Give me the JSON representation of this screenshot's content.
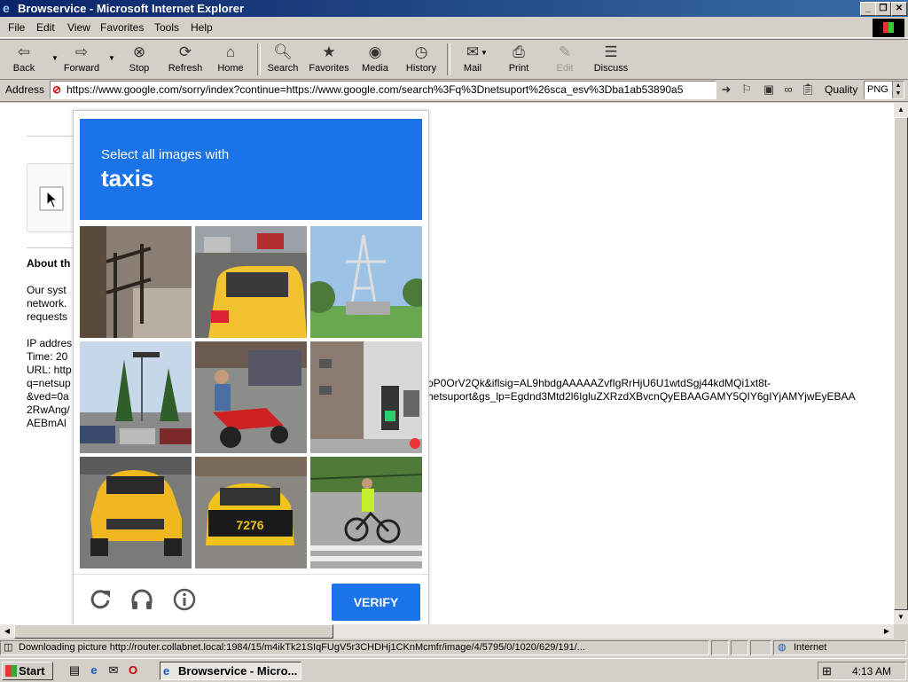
{
  "window": {
    "title": "Browservice - Microsoft Internet Explorer",
    "icon": "ie-icon",
    "buttons": [
      "minimize",
      "restore",
      "close"
    ]
  },
  "menu": [
    "File",
    "Edit",
    "View",
    "Favorites",
    "Tools",
    "Help"
  ],
  "toolbar": {
    "back": "Back",
    "forward": "Forward",
    "stop": "Stop",
    "refresh": "Refresh",
    "home": "Home",
    "search": "Search",
    "favorites": "Favorites",
    "media": "Media",
    "history": "History",
    "mail": "Mail",
    "print": "Print",
    "edit": "Edit",
    "discuss": "Discuss"
  },
  "address": {
    "label": "Address",
    "url": "https://www.google.com/sorry/index?continue=https://www.google.com/search%3Fq%3Dnetsuport%26sca_esv%3Dba1ab53890a5",
    "quality_label": "Quality",
    "quality_value": "PNG"
  },
  "page": {
    "about_heading": "About th",
    "body_lines": [
      "Our syst",
      "network.",
      "requests"
    ],
    "ip_line": "IP addres",
    "time_line": "Time: 20",
    "url_line": "URL: http",
    "q_line": "q=netsup",
    "ved_line": "&ved=0a",
    "rw_line": "2RwAng/",
    "aeb_line": "AEBmAl",
    "right_line_1": "oP0OrV2Qk&iflsig=AL9hbdgAAAAAZvfIgRrHjU6U1wtdSgj44kdMQi1xt8t-",
    "right_line_2": "netsuport&gs_lp=Egdnd3Mtd2l6IgluZXRzdXBvcnQyEBAAGAMY5QIY6gIYjAMYjwEyEBAA"
  },
  "captcha": {
    "instruction": "Select all images with",
    "object": "taxis",
    "verify_label": "VERIFY",
    "accent": "#1a73e8",
    "tiles": [
      {
        "name": "tile-railing"
      },
      {
        "name": "tile-taxi-street"
      },
      {
        "name": "tile-power-tower"
      },
      {
        "name": "tile-parking-street"
      },
      {
        "name": "tile-motorcycle"
      },
      {
        "name": "tile-traffic-light"
      },
      {
        "name": "tile-yellow-taxi"
      },
      {
        "name": "tile-taxi-7276"
      },
      {
        "name": "tile-cyclist"
      }
    ],
    "footer_icons": [
      "reload-icon",
      "audio-headphones-icon",
      "info-icon"
    ]
  },
  "status": {
    "text": "Downloading picture http://router.collabnet.local:1984/15/m4ikTk21SIqFUgV5r3CHDHj1CKnMcmfr/image/4/5795/0/1020/629/191/...",
    "zone": "Internet"
  },
  "taskbar": {
    "start": "Start",
    "task_item": "Browservice - Micro...",
    "clock": "4:13 AM"
  }
}
